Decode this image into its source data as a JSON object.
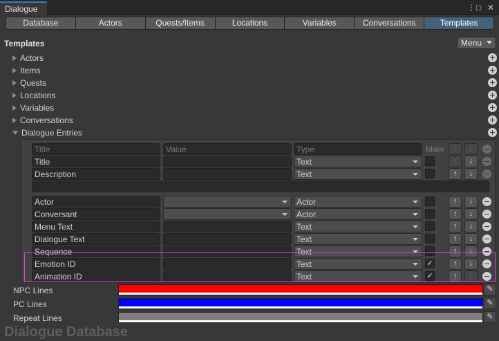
{
  "window": {
    "tab_title": "Dialogue",
    "menu_glyph": "⋮",
    "maximize_glyph": "□",
    "close_glyph": "✕"
  },
  "toolbar": {
    "tabs": [
      "Database",
      "Actors",
      "Quests/Items",
      "Locations",
      "Variables",
      "Conversations",
      "Templates"
    ],
    "active": "Templates"
  },
  "section": {
    "title": "Templates",
    "menu_label": "Menu"
  },
  "tree": [
    "Actors",
    "Items",
    "Quests",
    "Locations",
    "Variables",
    "Conversations",
    "Dialogue Entries"
  ],
  "fields": {
    "header": {
      "title": "Title",
      "value": "Value",
      "type": "Type",
      "main": "Main"
    },
    "rows": [
      {
        "title": "Title",
        "value": "",
        "type": "Text",
        "main": false
      },
      {
        "title": "Description",
        "value": "",
        "type": "Text",
        "main": false
      },
      {
        "title": "Actor",
        "value": "",
        "type": "Actor",
        "main": false
      },
      {
        "title": "Conversant",
        "value": "",
        "type": "Actor",
        "main": false
      },
      {
        "title": "Menu Text",
        "value": "",
        "type": "Text",
        "main": false
      },
      {
        "title": "Dialogue Text",
        "value": "",
        "type": "Text",
        "main": false
      },
      {
        "title": "Sequence",
        "value": "",
        "type": "Text",
        "main": false
      },
      {
        "title": "Emotion ID",
        "value": "",
        "type": "Text",
        "main": true
      },
      {
        "title": "Animation ID",
        "value": "",
        "type": "Text",
        "main": true
      }
    ]
  },
  "glyphs": {
    "up": "↑",
    "down": "↓",
    "check": "✓",
    "eyedropper": "✎"
  },
  "colors": [
    {
      "label": "NPC Lines",
      "hex": "#ff0000"
    },
    {
      "label": "PC Lines",
      "hex": "#0000ff"
    },
    {
      "label": "Repeat Lines",
      "hex": "#808080"
    }
  ],
  "footer": "Dialogue Database"
}
